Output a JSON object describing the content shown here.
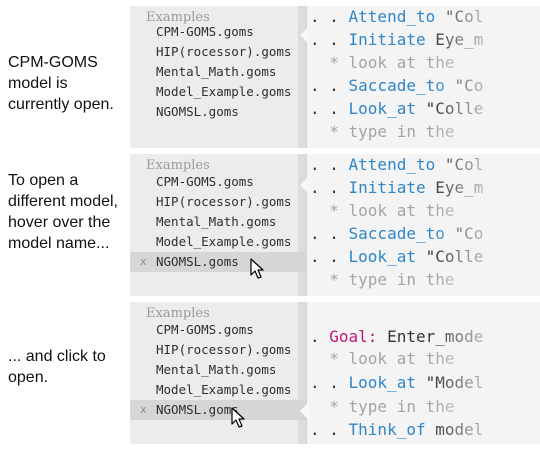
{
  "captions": [
    "CPM-GOMS model is currently open.",
    "To open a different model, hover over the model name...",
    "... and click to open."
  ],
  "sidebar": {
    "header": "Examples",
    "items": [
      "CPM-GOMS.goms",
      "HIP(rocessor).goms",
      "Mental_Math.goms",
      "Model_Example.goms",
      "NGOMSL.goms"
    ],
    "close_glyph": "x"
  },
  "code_panel_1": [
    {
      "dots": ". . ",
      "kw": "Attend_to",
      "arg": " \"Col"
    },
    {
      "dots": ". . ",
      "kw": "Initiate",
      "arg": " Eye_m"
    },
    {
      "dots": "  ",
      "comment": "* look at the"
    },
    {
      "dots": ". . ",
      "kw": "Saccade_to",
      "arg": " \"Co"
    },
    {
      "dots": ". . ",
      "kw": "Look_at",
      "arg": " \"Colle"
    },
    {
      "dots": "  ",
      "comment": "* type in the"
    }
  ],
  "code_panel_3": [
    {
      "dots": ". ",
      "goal": "Goal:",
      "arg": " Enter_mode"
    },
    {
      "dots": "  ",
      "comment": "* look at the"
    },
    {
      "dots": ". . ",
      "kw": "Look_at",
      "arg": " \"Model"
    },
    {
      "dots": "  ",
      "comment": "* type in the"
    },
    {
      "dots": ". . ",
      "kw": "Think_of",
      "arg": " model"
    }
  ],
  "colors": {
    "keyword": "#2f86c9",
    "goal": "#c2187a",
    "comment": "#a4a4a4"
  },
  "icons": {
    "cursor": "mouse-pointer-icon"
  }
}
